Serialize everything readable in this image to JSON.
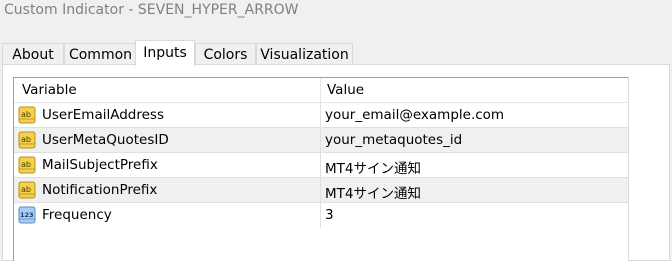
{
  "window": {
    "title": "Custom Indicator - SEVEN_HYPER_ARROW"
  },
  "tabs": [
    {
      "label": "About",
      "active": false
    },
    {
      "label": "Common",
      "active": false
    },
    {
      "label": "Inputs",
      "active": true
    },
    {
      "label": "Colors",
      "active": false
    },
    {
      "label": "Visualization",
      "active": false
    }
  ],
  "table": {
    "headers": {
      "variable": "Variable",
      "value": "Value"
    },
    "rows": [
      {
        "icon": "string-type-icon",
        "variable": "UserEmailAddress",
        "value": "your_email@example.com"
      },
      {
        "icon": "string-type-icon",
        "variable": "UserMetaQuotesID",
        "value": "your_metaquotes_id"
      },
      {
        "icon": "string-type-icon",
        "variable": "MailSubjectPrefix",
        "value": "MT4サイン通知"
      },
      {
        "icon": "string-type-icon",
        "variable": "NotificationPrefix",
        "value": "MT4サイン通知"
      },
      {
        "icon": "integer-type-icon",
        "variable": "Frequency",
        "value": "3"
      }
    ]
  },
  "colors": {
    "string_icon_fill": "#f5d04a",
    "string_icon_border": "#b8901a",
    "int_icon_fill": "#a9cdf0",
    "int_icon_border": "#5a8fc8",
    "alt_row": "#f0f0f0"
  }
}
